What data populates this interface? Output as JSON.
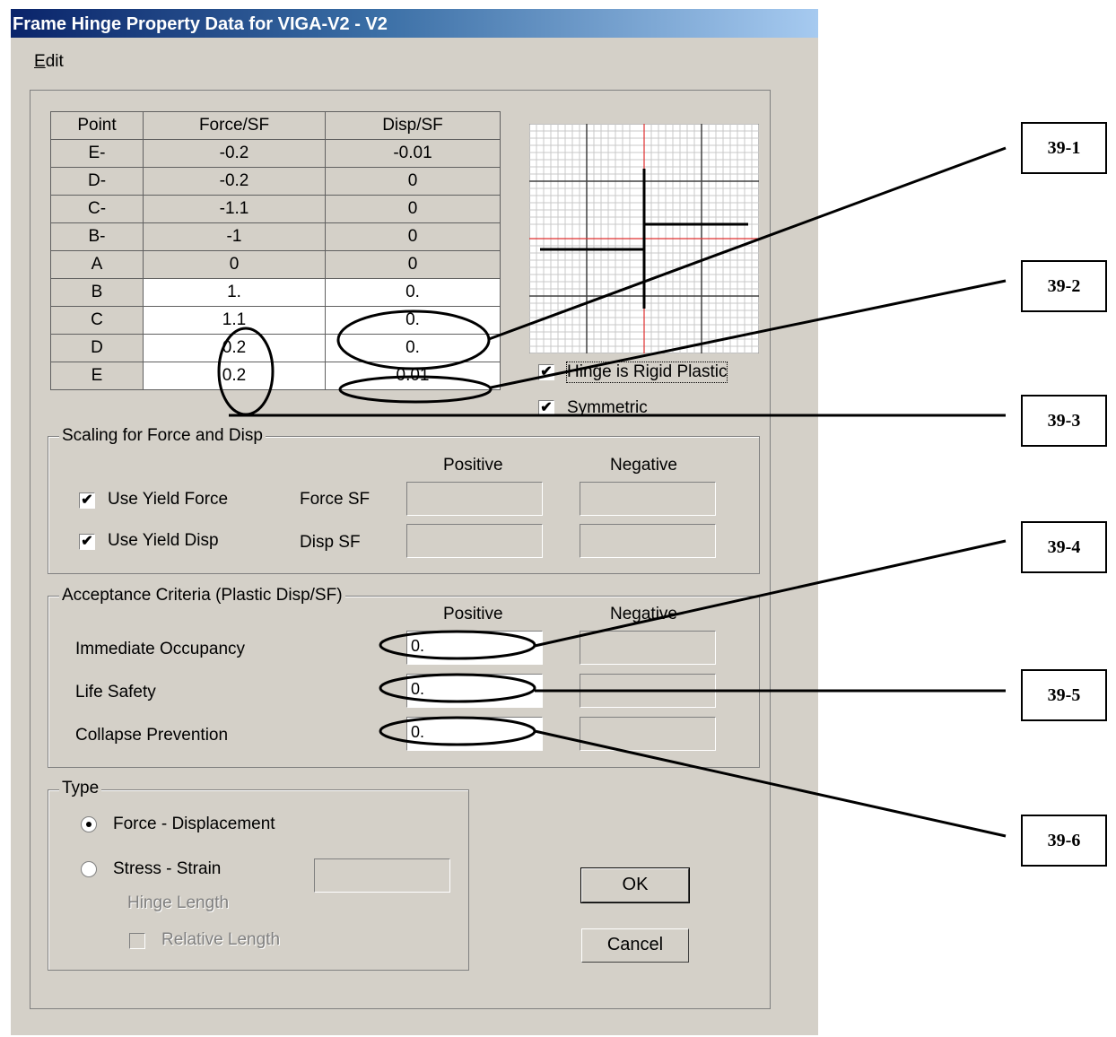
{
  "window": {
    "title": "Frame Hinge Property Data for VIGA-V2 - V2"
  },
  "menu": {
    "edit": "Edit"
  },
  "points_table": {
    "headers": [
      "Point",
      "Force/SF",
      "Disp/SF"
    ],
    "rows": [
      {
        "point": "E-",
        "force": "-0.2",
        "disp": "-0.01"
      },
      {
        "point": "D-",
        "force": "-0.2",
        "disp": "0"
      },
      {
        "point": "C-",
        "force": "-1.1",
        "disp": "0"
      },
      {
        "point": "B-",
        "force": "-1",
        "disp": "0"
      },
      {
        "point": "A",
        "force": "0",
        "disp": "0"
      },
      {
        "point": "B",
        "force": "1.",
        "disp": "0."
      },
      {
        "point": "C",
        "force": "1.1",
        "disp": "0."
      },
      {
        "point": "D",
        "force": "0.2",
        "disp": "0."
      },
      {
        "point": "E",
        "force": "0.2",
        "disp": "0.01"
      }
    ]
  },
  "options": {
    "rigid_plastic": "Hinge is Rigid Plastic",
    "rigid_plastic_checked": true,
    "symmetric": "Symmetric",
    "symmetric_checked": true
  },
  "scaling": {
    "title": "Scaling for Force and Disp",
    "positive": "Positive",
    "negative": "Negative",
    "use_yield_force": "Use Yield Force",
    "use_yield_force_checked": true,
    "use_yield_disp": "Use Yield Disp",
    "use_yield_disp_checked": true,
    "force_sf": "Force SF",
    "disp_sf": "Disp SF"
  },
  "acceptance": {
    "title": "Acceptance Criteria (Plastic Disp/SF)",
    "positive": "Positive",
    "negative": "Negative",
    "io_label": "Immediate Occupancy",
    "io_pos": "0.",
    "ls_label": "Life Safety",
    "ls_pos": "0.",
    "cp_label": "Collapse Prevention",
    "cp_pos": "0."
  },
  "type": {
    "title": "Type",
    "force_disp": "Force - Displacement",
    "force_disp_selected": true,
    "stress_strain": "Stress - Strain",
    "hinge_length": "Hinge Length",
    "relative_length": "Relative Length"
  },
  "buttons": {
    "ok": "OK",
    "cancel": "Cancel"
  },
  "callouts": [
    "39-1",
    "39-2",
    "39-3",
    "39-4",
    "39-5",
    "39-6"
  ]
}
